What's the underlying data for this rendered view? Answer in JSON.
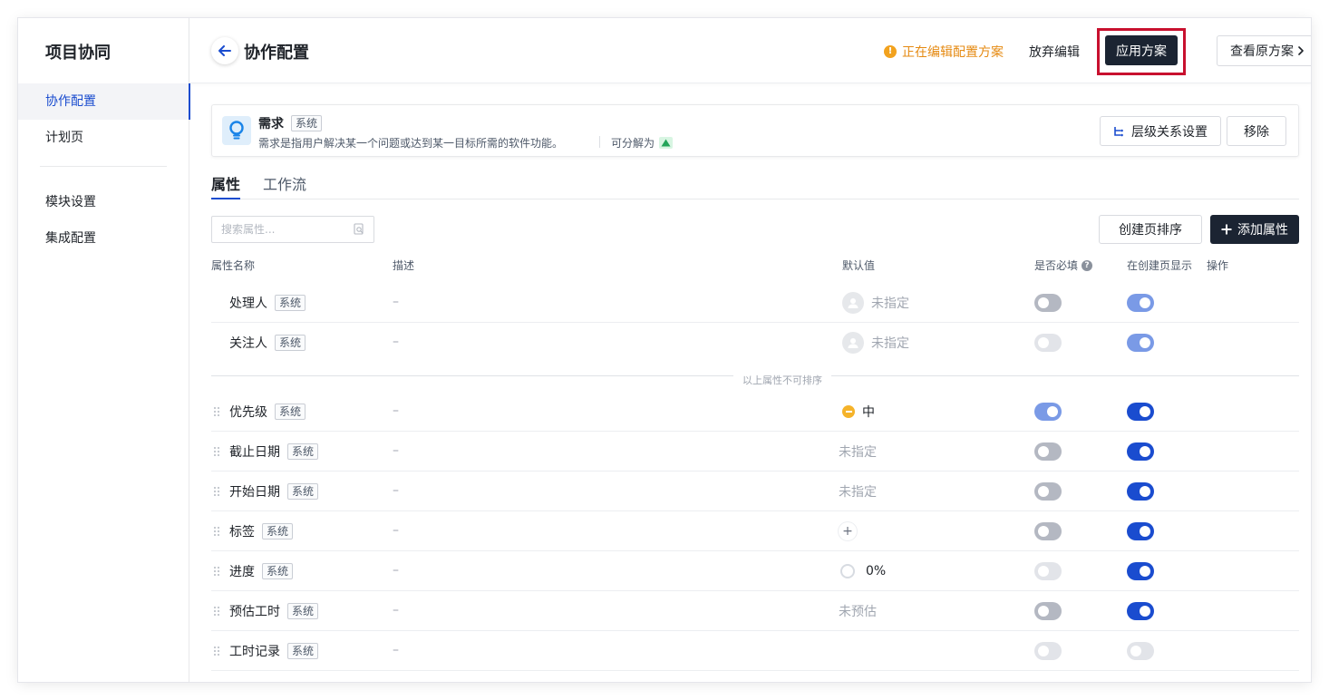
{
  "sidebar": {
    "app_title": "项目协同",
    "items": [
      {
        "label": "协作配置",
        "active": true
      },
      {
        "label": "计划页",
        "active": false
      },
      {
        "label": "模块设置",
        "active": false
      },
      {
        "label": "集成配置",
        "active": false
      }
    ]
  },
  "header": {
    "title": "协作配置",
    "editing_status": "正在编辑配置方案",
    "discard_label": "放弃编辑",
    "apply_label": "应用方案",
    "view_original_label": "查看原方案"
  },
  "type_card": {
    "name": "需求",
    "tag": "系统",
    "description": "需求是指用户解决某一个问题或达到某一目标所需的软件功能。",
    "decompose_label": "可分解为",
    "hierarchy_button": "层级关系设置",
    "remove_button": "移除"
  },
  "tabs": [
    {
      "label": "属性",
      "active": true
    },
    {
      "label": "工作流",
      "active": false
    }
  ],
  "toolbar": {
    "search_placeholder": "搜索属性...",
    "sort_button": "创建页排序",
    "add_button": "添加属性"
  },
  "table": {
    "headers": {
      "name": "属性名称",
      "desc": "描述",
      "default": "默认值",
      "required": "是否必填",
      "show_on_create": "在创建页显示",
      "actions": "操作"
    },
    "section_label": "以上属性不可排序",
    "fixed_rows": [
      {
        "name": "处理人",
        "tag": "系统",
        "desc": "–",
        "default": "未指定",
        "required": "off",
        "show": "on-dis"
      },
      {
        "name": "关注人",
        "tag": "系统",
        "desc": "–",
        "default": "未指定",
        "required": "off-dis",
        "show": "on-dis"
      }
    ],
    "rows": [
      {
        "name": "优先级",
        "tag": "系统",
        "desc": "–",
        "default": "中",
        "required": "on-dis",
        "show": "on"
      },
      {
        "name": "截止日期",
        "tag": "系统",
        "desc": "–",
        "default": "未指定",
        "required": "off",
        "show": "on"
      },
      {
        "name": "开始日期",
        "tag": "系统",
        "desc": "–",
        "default": "未指定",
        "required": "off",
        "show": "on"
      },
      {
        "name": "标签",
        "tag": "系统",
        "desc": "–",
        "default": "+",
        "required": "off",
        "show": "on"
      },
      {
        "name": "进度",
        "tag": "系统",
        "desc": "–",
        "default": "0%",
        "required": "off-dis",
        "show": "on"
      },
      {
        "name": "预估工时",
        "tag": "系统",
        "desc": "–",
        "default": "未预估",
        "required": "off",
        "show": "on"
      },
      {
        "name": "工时记录",
        "tag": "系统",
        "desc": "–",
        "default": "",
        "required": "off-dis",
        "show": "off-dis"
      }
    ]
  },
  "colors": {
    "accent": "#1a4ccf",
    "dark_button": "#1b2432",
    "warning": "#e58a12",
    "highlight": "#c8102e"
  }
}
